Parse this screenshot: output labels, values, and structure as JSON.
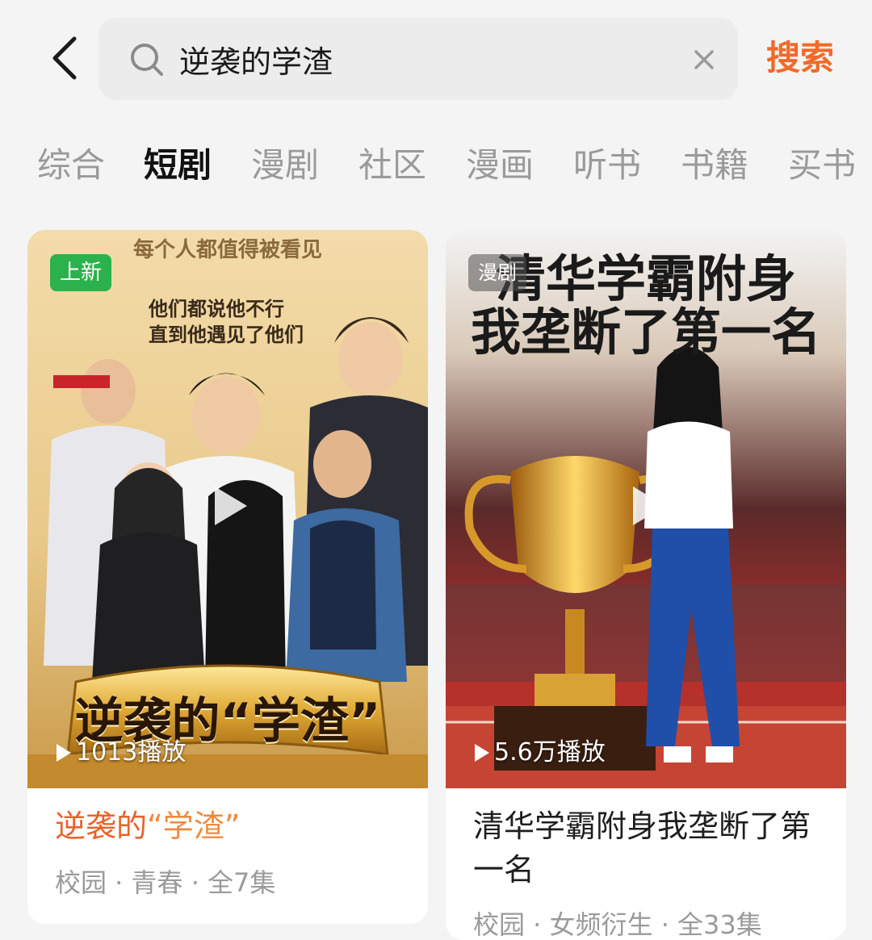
{
  "search": {
    "query": "逆袭的学渣",
    "submit_label": "搜索"
  },
  "tabs": [
    {
      "label": "综合",
      "active": false
    },
    {
      "label": "短剧",
      "active": true
    },
    {
      "label": "漫剧",
      "active": false
    },
    {
      "label": "社区",
      "active": false
    },
    {
      "label": "漫画",
      "active": false
    },
    {
      "label": "听书",
      "active": false
    },
    {
      "label": "书籍",
      "active": false
    },
    {
      "label": "买书",
      "active": false
    }
  ],
  "results": [
    {
      "badge": "上新",
      "cover_top_text": "每个人都值得被看见",
      "cover_tagline_1": "他们都说他不行",
      "cover_tagline_2": "直到他遇见了他们",
      "cover_title": "逆袭的“学渣”",
      "play_count": "1013播放",
      "title_prefix": "逆袭的",
      "title_highlight": "“学渣”",
      "meta": "校园 · 青春 · 全7集"
    },
    {
      "badge": "漫剧",
      "cover_title_1": "清华学霸附身",
      "cover_title_2": "我垄断了第一名",
      "play_count": "5.6万播放",
      "title": "清华学霸附身我垄断了第一名",
      "meta": "校园 · 女频衍生 · 全33集"
    }
  ],
  "colors": {
    "accent": "#f06a2a",
    "badge_new": "#2bb24c",
    "tab_active": "#111111",
    "tab_inactive": "#9a9a9a"
  },
  "icons": {
    "back": "chevron-left-icon",
    "search": "search-icon",
    "clear": "close-icon",
    "play": "play-icon"
  }
}
